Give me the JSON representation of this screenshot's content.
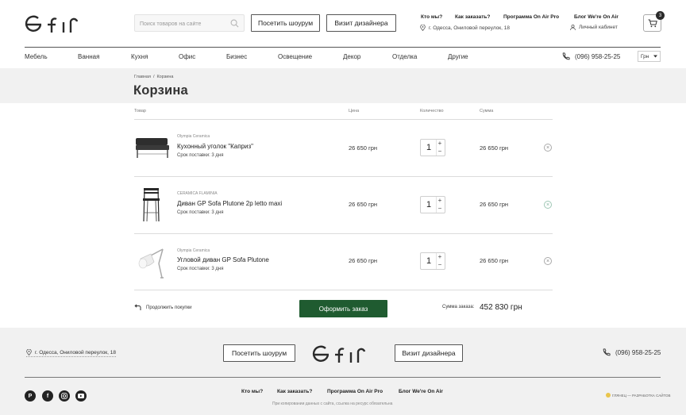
{
  "header": {
    "logo_text": "efir",
    "search": {
      "placeholder": "Поиск товаров на сайте"
    },
    "buttons": {
      "showroom": "Посетить шоурум",
      "designer": "Визит дизайнера"
    },
    "links": [
      "Кто мы?",
      "Как заказать?",
      "Программа On Air Pro",
      "Блог We're On Air"
    ],
    "address": "г. Одесса, Ониловой переулок, 18",
    "cabinet": "Личный кабинет",
    "cart_count": "3"
  },
  "nav": {
    "items": [
      "Мебель",
      "Ванная",
      "Кухня",
      "Офис",
      "Бизнес",
      "Освещение",
      "Декор",
      "Отделка",
      "Другие"
    ],
    "phone": "(096) 958-25-25",
    "currency": "Грн"
  },
  "breadcrumbs": {
    "home": "Главная",
    "separator": "/",
    "current": "Корзина"
  },
  "page_title": "Корзина",
  "table": {
    "headers": {
      "product": "Товар",
      "price": "Цена",
      "quantity": "Количество",
      "sum": "Сумма"
    },
    "rows": [
      {
        "brand": "Olympia Ceramica",
        "name": "Кухонный уголок \"Каприз\"",
        "delivery": "Срок поставки: 3 дня",
        "price": "26 650 грн",
        "qty": "1",
        "sum": "26 650 грн"
      },
      {
        "brand": "CERAMICA FLAMINIA",
        "name": "Диван GP Sofa Plutone 2p letto maxi",
        "delivery": "Срок поставки: 3 дня",
        "price": "26 650 грн",
        "qty": "1",
        "sum": "26 650 грн"
      },
      {
        "brand": "Olympia Ceramica",
        "name": "Угловой диван GP Sofa Plutone",
        "delivery": "Срок поставки: 3 дня",
        "price": "26 650 грн",
        "qty": "1",
        "sum": "26 650 грн"
      }
    ]
  },
  "summary": {
    "continue": "Продолжить покупки",
    "checkout": "Оформить заказ",
    "total_label": "Сумма заказа:",
    "total_value": "452 830 грн"
  },
  "footer": {
    "address": "г. Одесса, Ониловой переулок, 18",
    "showroom": "Посетить шоурум",
    "designer": "Визит дизайнера",
    "phone": "(096) 958-25-25",
    "social": [
      "pinterest-icon",
      "facebook-icon",
      "instagram-icon",
      "youtube-icon"
    ],
    "links": [
      "Кто мы?",
      "Как заказать?",
      "Программа On Air Pro",
      "Блог We're On Air"
    ],
    "copyright": "При копировании данных с сайта, ссылка на ресурс обязательна",
    "developer": "ГЛЯНЕЦ — РАЗРАБОТКА САЙТОВ"
  },
  "colors": {
    "accent_green": "#1f5b30",
    "band_gray": "#f1f1f1",
    "text": "#2b2b2b"
  }
}
